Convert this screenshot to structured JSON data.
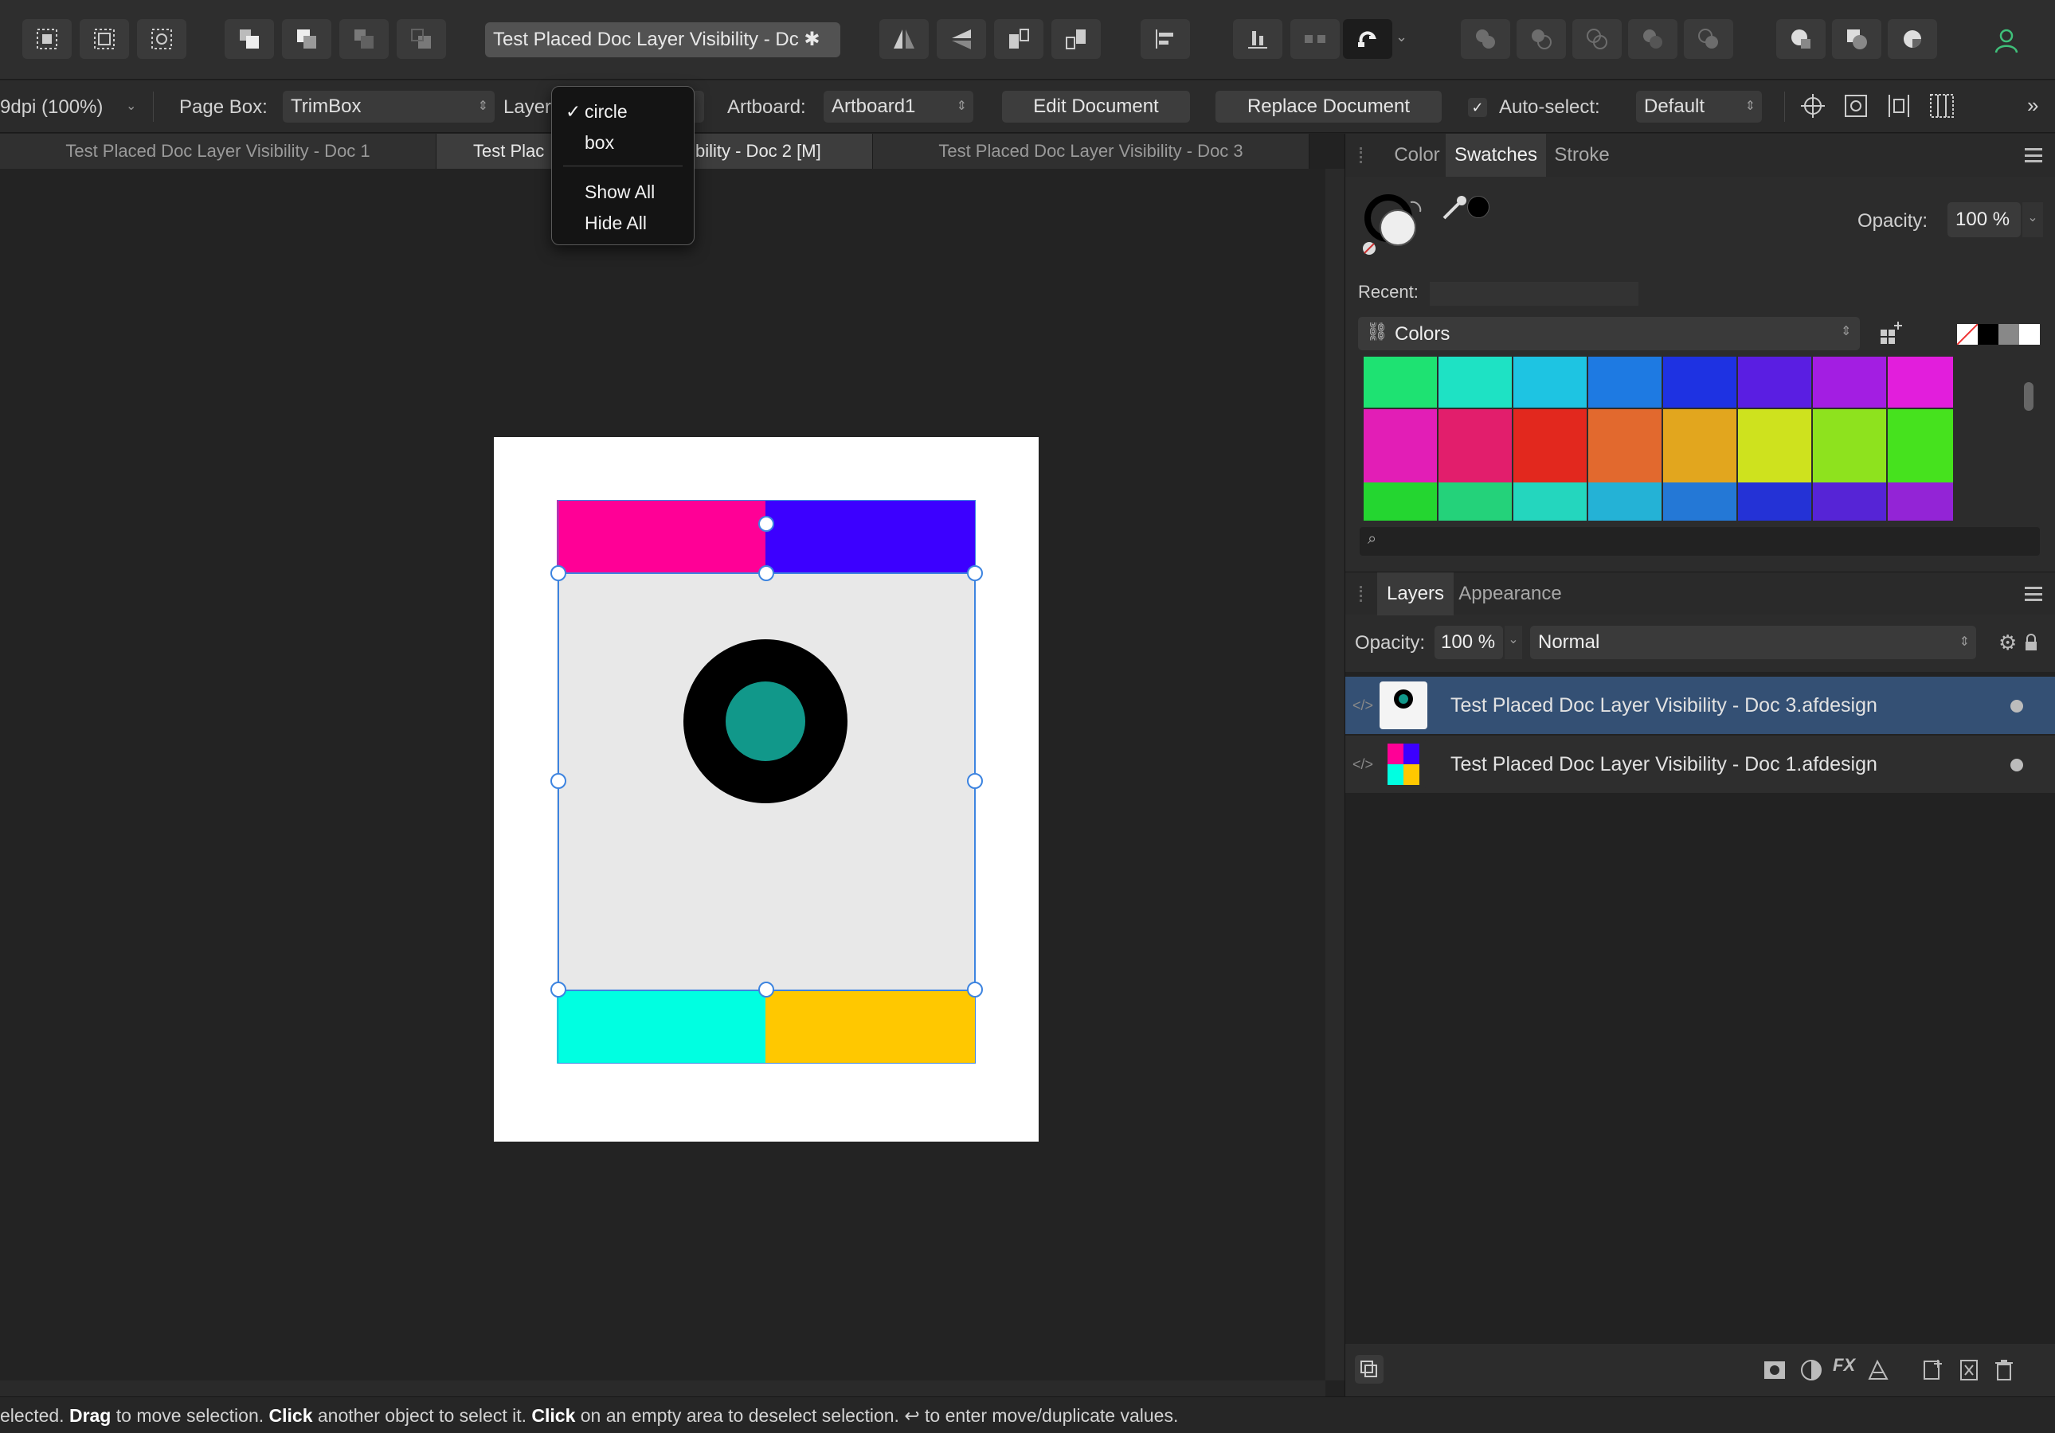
{
  "toolbar": {
    "document_title": "Test Placed Doc Layer Visibility - Dc ✱",
    "icons": [
      "snap-select-icon",
      "snap-frame-icon",
      "snap-object-icon",
      "arrange-front-icon",
      "arrange-forward-icon",
      "arrange-backward-icon",
      "arrange-back-icon",
      "flip-horizontal-icon",
      "flip-vertical-icon",
      "rotate-left-icon",
      "rotate-right-icon",
      "align-icon",
      "distribute-icon",
      "transform-icon",
      "snapping-magnet-icon",
      "boolean-add-icon",
      "boolean-subtract-icon",
      "boolean-intersect-icon",
      "boolean-xor-icon",
      "boolean-divide-icon",
      "persona-designer-icon",
      "persona-pixel-icon",
      "persona-export-icon",
      "user-account-icon"
    ]
  },
  "context": {
    "dpi": "9dpi (100%)",
    "page_box_label": "Page Box:",
    "page_box_value": "TrimBox",
    "layer_label": "Layer",
    "artboard_label": "Artboard:",
    "artboard_value": "Artboard1",
    "edit_document": "Edit Document",
    "replace_document": "Replace Document",
    "auto_select_label": "Auto-select:",
    "auto_select_value": "Default",
    "auto_select_checked": true
  },
  "tabs": [
    {
      "label": "Test Placed Doc Layer Visibility - Doc 1",
      "active": false
    },
    {
      "label": "Test Plac",
      "active": true
    },
    {
      "label": "bility - Doc 2 [M]",
      "active": true
    },
    {
      "label": "Test Placed Doc Layer Visibility - Doc 3",
      "active": false
    }
  ],
  "layer_menu": {
    "items": [
      {
        "label": "circle",
        "checked": true
      },
      {
        "label": "box",
        "checked": false
      },
      {
        "label": "Show All",
        "checked": false
      },
      {
        "label": "Hide All",
        "checked": false
      }
    ]
  },
  "canvas": {
    "artwork_colors": {
      "magenta": "#ff0096",
      "violet": "#3c00ff",
      "cyan": "#00ffe1",
      "yellow": "#ffc800",
      "ring": "#000000",
      "dot": "#11988a",
      "panel": "#e8e8e8",
      "selection": "#3d84e0"
    }
  },
  "color_panel": {
    "tabs": [
      "Color",
      "Swatches",
      "Stroke"
    ],
    "active_tab": "Swatches",
    "opacity_label": "Opacity:",
    "opacity_value": "100 %",
    "recent_label": "Recent:",
    "palette_name": "Colors",
    "swatch_rows": [
      [
        "#1ee272",
        "#1ee2c4",
        "#1ec4e2",
        "#1e7ae2",
        "#1e32e2",
        "#5a1ee2",
        "#a31ee2",
        "#e21edc"
      ],
      [
        "#e21eb6",
        "#e21e6c",
        "#e2281e",
        "#e2692e",
        "#e2a61e",
        "#cee21e",
        "#8ee21e",
        "#46e21e"
      ],
      [
        "#24d630",
        "#24d27a",
        "#24d6be",
        "#24b2d6",
        "#2478d6",
        "#2432d6",
        "#5624d6",
        "#9324d6"
      ]
    ]
  },
  "layers_panel": {
    "tabs": [
      "Layers",
      "Appearance"
    ],
    "active_tab": "Layers",
    "opacity_label": "Opacity:",
    "opacity_value": "100 %",
    "blend_mode": "Normal",
    "layers": [
      {
        "name": "Test Placed Doc Layer Visibility - Doc 3.afdesign",
        "selected": true
      },
      {
        "name": "Test Placed Doc Layer Visibility - Doc 1.afdesign",
        "selected": false
      }
    ]
  },
  "status": {
    "parts": [
      {
        "text": "elected. ",
        "bold": false
      },
      {
        "text": "Drag",
        "bold": true
      },
      {
        "text": " to move selection. ",
        "bold": false
      },
      {
        "text": "Click",
        "bold": true
      },
      {
        "text": " another object to select it. ",
        "bold": false
      },
      {
        "text": "Click",
        "bold": true
      },
      {
        "text": " on an empty area to deselect selection. ↩ to enter move/duplicate values.",
        "bold": false
      }
    ]
  }
}
